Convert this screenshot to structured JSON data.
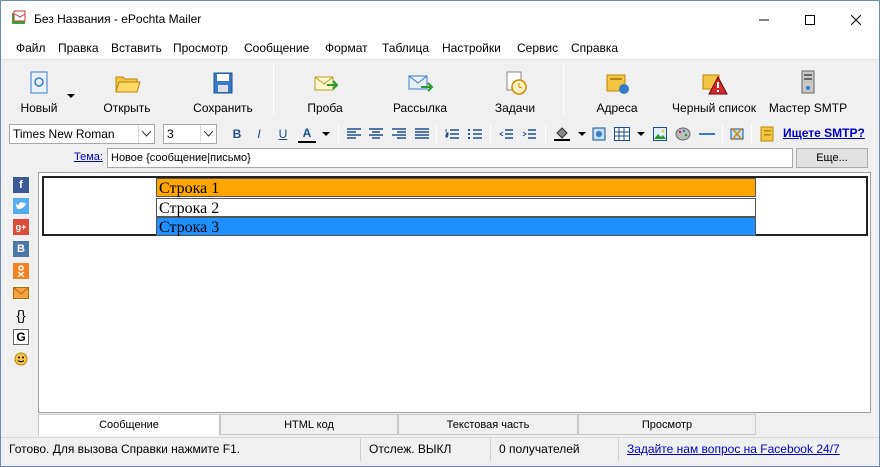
{
  "window": {
    "title": "Без Названия - ePochta Mailer"
  },
  "menu": [
    "Файл",
    "Правка",
    "Вставить",
    "Просмотр",
    "Сообщение",
    "Формат",
    "Таблица",
    "Настройки",
    "Сервис",
    "Справка"
  ],
  "toolbar": {
    "new": "Новый",
    "open": "Открыть",
    "save": "Сохранить",
    "test": "Проба",
    "send": "Рассылка",
    "tasks": "Задачи",
    "addresses": "Адреса",
    "blacklist": "Черный список",
    "smtp_wizard": "Мастер SMTP"
  },
  "format": {
    "font": "Times New Roman",
    "size": "3",
    "bold": "B",
    "italic": "I",
    "underline": "U",
    "font_color": "A",
    "smtp_link": "Ищете SMTP?"
  },
  "subject": {
    "label": "Тема:",
    "value": "Новое {сообщение|письмо}",
    "more_button": "Еще..."
  },
  "sidebar": {
    "braces": "{}",
    "google": "G"
  },
  "editor": {
    "rows": [
      {
        "text": "Строка 1",
        "color": "#ffa500"
      },
      {
        "text": "Строка 2",
        "color": "#ffffff"
      },
      {
        "text": "Строка 3",
        "color": "#1e90ff"
      }
    ]
  },
  "tabs": [
    "Сообщение",
    "HTML код",
    "Текстовая часть",
    "Просмотр"
  ],
  "status": {
    "ready": "Готово. Для вызова Справки нажмите F1.",
    "tracking": "Отслеж. ВЫКЛ",
    "recipients": "0 получателей",
    "facebook": "Задайте нам вопрос на Facebook 24/7"
  }
}
